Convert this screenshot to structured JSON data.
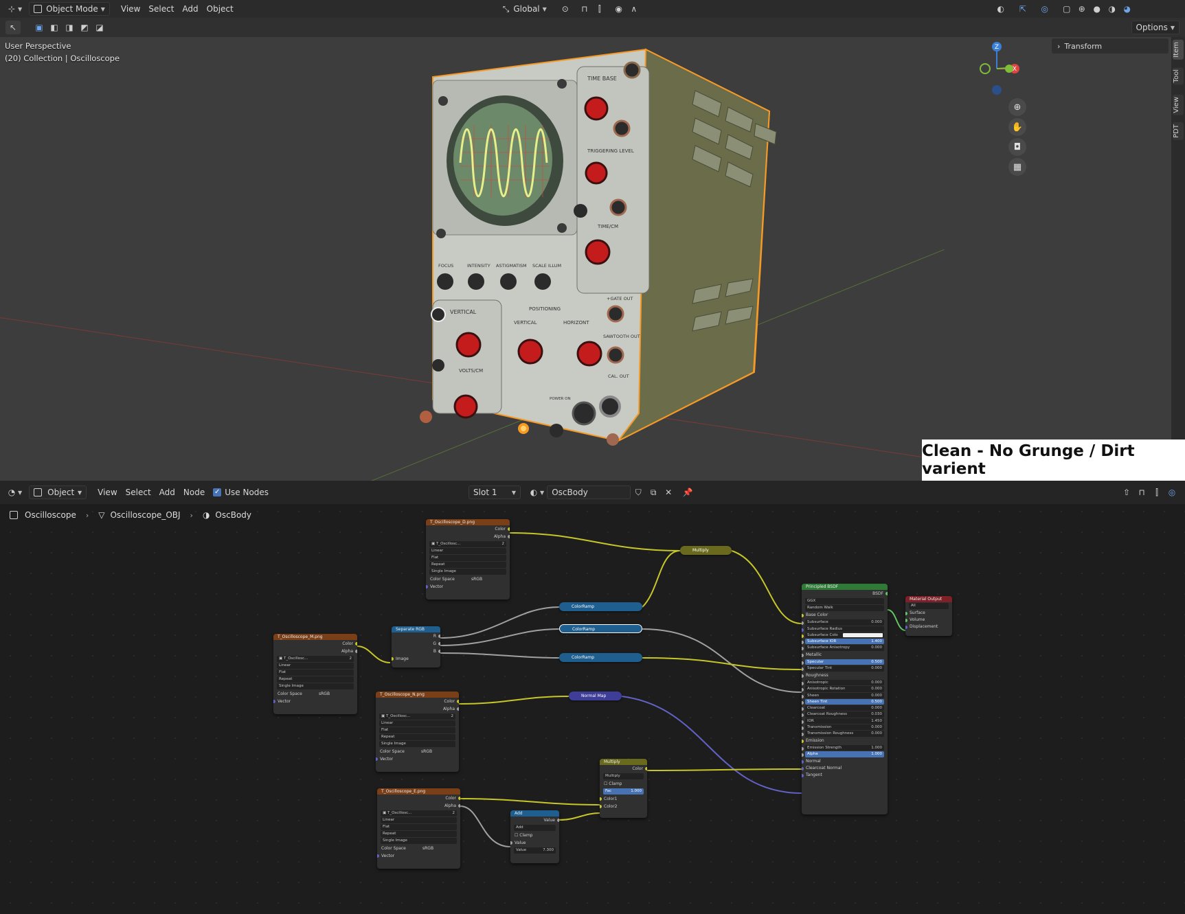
{
  "viewport": {
    "mode": "Object Mode",
    "menus": [
      "View",
      "Select",
      "Add",
      "Object"
    ],
    "orientation": "Global",
    "options_label": "Options",
    "overlay_line1": "User Perspective",
    "overlay_line2": "(20) Collection | Oscilloscope",
    "transform_label": "Transform",
    "sidebar_tabs": [
      "Item",
      "Tool",
      "View",
      "PDT"
    ],
    "axes": {
      "x": "X",
      "y": "Y",
      "z": "Z"
    },
    "colors": {
      "x_axis": "#e0443f",
      "y_axis": "#7fbe3b",
      "z_axis": "#3a7fd8",
      "selection": "#f59a26"
    }
  },
  "scope_labels": {
    "time_base": "TIME BASE",
    "triggering_level": "TRIGGERING LEVEL",
    "time_cm": "TIME/CM",
    "focus": "FOCUS",
    "intensity": "INTENSITY",
    "astigmatism": "ASTIGMATISM",
    "scale_illum": "SCALE ILLUM",
    "vertical": "VERTICAL",
    "volts_cm": "VOLTS/CM",
    "positioning": "POSITIONING",
    "vertical2": "VERTICAL",
    "horizontal": "HORIZONT",
    "gate_out": "+GATE OUT",
    "sawtooth_out": "SAWTOOTH OUT",
    "cal_out": "CAL. OUT",
    "power_on": "POWER ON"
  },
  "caption": "Clean - No Grunge / Dirt varient",
  "node_editor": {
    "editor_type": "Object",
    "menus": [
      "View",
      "Select",
      "Add",
      "Node"
    ],
    "use_nodes_label": "Use Nodes",
    "slot": "Slot 1",
    "material": "OscBody",
    "breadcrumb": [
      "Oscilloscope",
      "Oscilloscope_OBJ",
      "OscBody"
    ]
  },
  "nodes": {
    "tex_d": {
      "title": "T_Oscilloscope_D.png",
      "outputs": [
        "Color",
        "Alpha"
      ],
      "image": "T_Oscillosc...",
      "users": "2",
      "fields": [
        "Linear",
        "Flat",
        "Repeat",
        "Single Image"
      ],
      "colorspace_label": "Color Space",
      "colorspace": "sRGB",
      "input": "Vector"
    },
    "tex_m": {
      "title": "T_Oscilloscope_M.png",
      "outputs": [
        "Color",
        "Alpha"
      ],
      "image": "T_Oscillosc...",
      "users": "2",
      "fields": [
        "Linear",
        "Flat",
        "Repeat",
        "Single Image"
      ],
      "colorspace_label": "Color Space",
      "colorspace": "sRGB",
      "input": "Vector"
    },
    "tex_n": {
      "title": "T_Oscilloscope_N.png",
      "outputs": [
        "Color",
        "Alpha"
      ],
      "image": "T_Oscillosc...",
      "users": "2",
      "fields": [
        "Linear",
        "Flat",
        "Repeat",
        "Single Image"
      ],
      "colorspace_label": "Color Space",
      "colorspace": "sRGB",
      "input": "Vector"
    },
    "tex_e": {
      "title": "T_Oscilloscope_E.png",
      "outputs": [
        "Color",
        "Alpha"
      ],
      "image": "T_Oscillosc...",
      "users": "2",
      "fields": [
        "Linear",
        "Flat",
        "Repeat",
        "Single Image"
      ],
      "colorspace_label": "Color Space",
      "colorspace": "sRGB",
      "input": "Vector"
    },
    "sep": {
      "title": "Separate RGB",
      "outputs": [
        "R",
        "G",
        "B"
      ],
      "input": "Image"
    },
    "ramp1": {
      "title": "ColorRamp"
    },
    "ramp2": {
      "title": "ColorRamp"
    },
    "ramp3": {
      "title": "ColorRamp"
    },
    "normal_map": {
      "title": "Normal Map"
    },
    "multiply_top": {
      "title": "Multiply"
    },
    "multiply": {
      "title": "Multiply",
      "output": "Color",
      "blend": "Multiply",
      "clamp": "Clamp",
      "fac_label": "Fac",
      "fac": "1.000",
      "inputs": [
        "Color1",
        "Color2"
      ]
    },
    "add": {
      "title": "Add",
      "output": "Value",
      "op": "Add",
      "clamp": "Clamp",
      "input": "Value",
      "value_label": "Value",
      "value": "7.300"
    },
    "bsdf": {
      "title": "Principled BSDF",
      "output": "BSDF",
      "dist": "GGX",
      "sss": "Random Walk",
      "rows": [
        {
          "label": "Base Color",
          "type": "socket"
        },
        {
          "label": "Subsurface",
          "value": "0.000",
          "type": "field"
        },
        {
          "label": "Subsurface Radius",
          "type": "dropdown"
        },
        {
          "label": "Subsurface Colo",
          "type": "color"
        },
        {
          "label": "Subsurface IOR",
          "value": "1.400",
          "type": "blue"
        },
        {
          "label": "Subsurface Anisotropy",
          "value": "0.000",
          "type": "field"
        },
        {
          "label": "Metallic",
          "type": "socket"
        },
        {
          "label": "Specular",
          "value": "0.500",
          "type": "blue"
        },
        {
          "label": "Specular Tint",
          "value": "0.000",
          "type": "field"
        },
        {
          "label": "Roughness",
          "type": "socket"
        },
        {
          "label": "Anisotropic",
          "value": "0.000",
          "type": "field"
        },
        {
          "label": "Anisotropic Rotation",
          "value": "0.000",
          "type": "field"
        },
        {
          "label": "Sheen",
          "value": "0.000",
          "type": "field"
        },
        {
          "label": "Sheen Tint",
          "value": "0.500",
          "type": "blue"
        },
        {
          "label": "Clearcoat",
          "value": "0.000",
          "type": "field"
        },
        {
          "label": "Clearcoat Roughness",
          "value": "0.030",
          "type": "field"
        },
        {
          "label": "IOR",
          "value": "1.450",
          "type": "field"
        },
        {
          "label": "Transmission",
          "value": "0.000",
          "type": "field"
        },
        {
          "label": "Transmission Roughness",
          "value": "0.000",
          "type": "field"
        },
        {
          "label": "Emission",
          "type": "socket"
        },
        {
          "label": "Emission Strength",
          "value": "1.000",
          "type": "field"
        },
        {
          "label": "Alpha",
          "value": "1.000",
          "type": "blue"
        },
        {
          "label": "Normal",
          "type": "socket"
        },
        {
          "label": "Clearcoat Normal",
          "type": "socket"
        },
        {
          "label": "Tangent",
          "type": "socket"
        }
      ]
    },
    "output": {
      "title": "Material Output",
      "target": "All",
      "inputs": [
        "Surface",
        "Volume",
        "Displacement"
      ]
    }
  }
}
